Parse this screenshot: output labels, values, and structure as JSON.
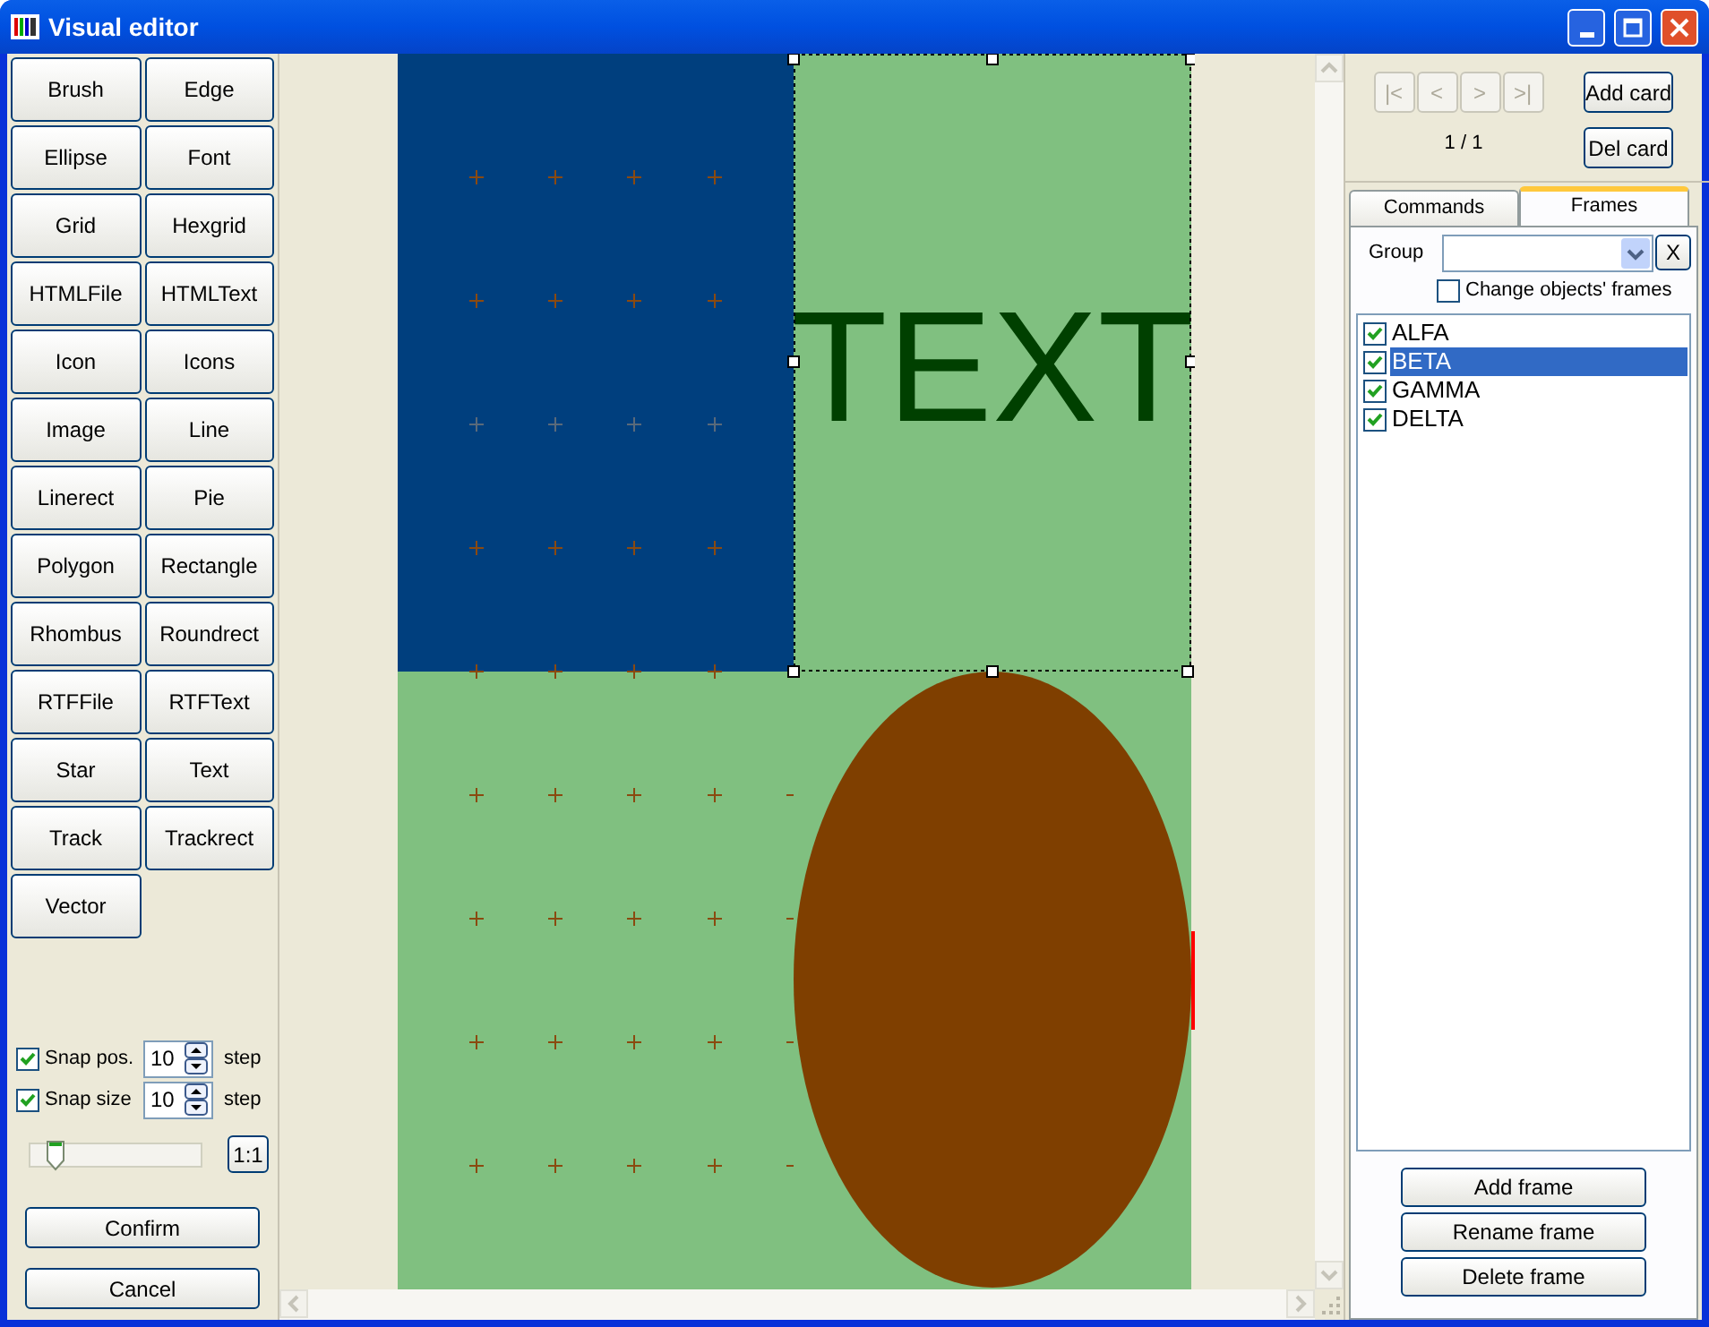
{
  "window": {
    "title": "Visual editor"
  },
  "tools": [
    "Brush",
    "Edge",
    "Ellipse",
    "Font",
    "Grid",
    "Hexgrid",
    "HTMLFile",
    "HTMLText",
    "Icon",
    "Icons",
    "Image",
    "Line",
    "Linerect",
    "Pie",
    "Polygon",
    "Rectangle",
    "Rhombus",
    "Roundrect",
    "RTFFile",
    "RTFText",
    "Star",
    "Text",
    "Track",
    "Trackrect",
    "Vector"
  ],
  "snap": [
    {
      "label": "Snap pos.",
      "checked": true,
      "value": "10",
      "unit": "step"
    },
    {
      "label": "Snap size",
      "checked": true,
      "value": "10",
      "unit": "step"
    }
  ],
  "zoom": {
    "level": 0.1,
    "button": "1:1"
  },
  "buttons": [
    "Confirm",
    "Cancel"
  ],
  "canvas": {
    "text": "TEXT"
  },
  "navigation": [
    {
      "label": "|<",
      "disabled": true
    },
    {
      "label": "<",
      "disabled": true
    },
    {
      "label": ">",
      "disabled": true
    },
    {
      "label": ">|",
      "disabled": true
    }
  ],
  "page": "1 / 1",
  "card_buttons": [
    "Add card",
    "Del card"
  ],
  "tabs": [
    {
      "label": "Commands",
      "selected": false
    },
    {
      "label": "Frames",
      "selected": true
    }
  ],
  "group": {
    "label": "Group",
    "clear": "X"
  },
  "change_frames": {
    "label": "Change objects' frames",
    "checked": false
  },
  "frames": [
    {
      "name": "ALFA",
      "checked": true,
      "selected": false
    },
    {
      "name": "BETA",
      "checked": true,
      "selected": true
    },
    {
      "name": "GAMMA",
      "checked": true,
      "selected": false
    },
    {
      "name": "DELTA",
      "checked": true,
      "selected": false
    }
  ],
  "frame_buttons": [
    "Add frame",
    "Rename frame",
    "Delete frame"
  ]
}
